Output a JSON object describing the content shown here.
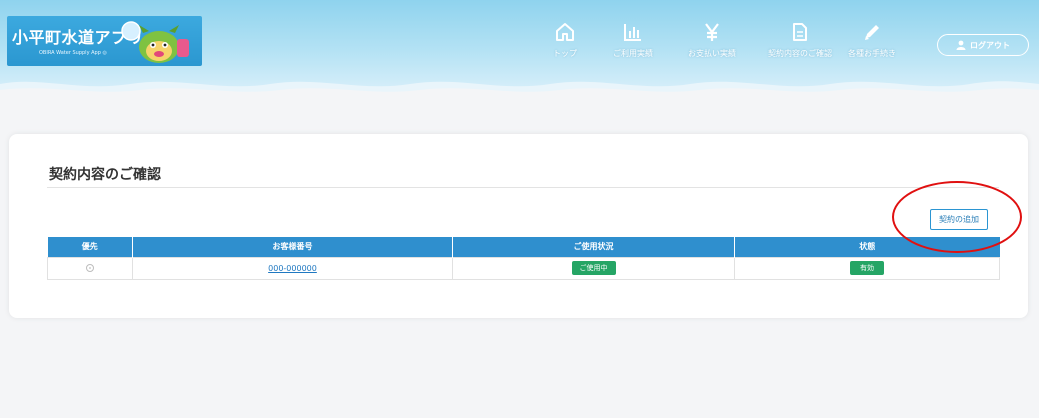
{
  "header": {
    "app_title": "小平町水道アプリ",
    "app_subtitle": "OBIRA Water Supply App ◎",
    "colors": {
      "header_bg": "#a9ddf2",
      "logo_bg": "#3ca9df",
      "accent": "#2f8fce"
    },
    "nav": [
      {
        "icon": "home-icon",
        "label": "トップ"
      },
      {
        "icon": "bar-chart-icon",
        "label": "ご利用実績"
      },
      {
        "icon": "yen-icon",
        "label": "お支払い実績"
      },
      {
        "icon": "document-icon",
        "label": "契約内容のご確認"
      },
      {
        "icon": "pencil-icon",
        "label": "各種お手続き"
      }
    ],
    "logout_label": "ログアウト"
  },
  "main": {
    "page_title": "契約内容のご確認",
    "add_button_label": "契約の追加",
    "table": {
      "columns": [
        "優先",
        "お客様番号",
        "ご使用状況",
        "状態"
      ],
      "rows": [
        {
          "customer_number": "000-000000",
          "usage_status": "ご使用中",
          "state": "有効"
        }
      ]
    },
    "badge_color": "#25a565"
  }
}
